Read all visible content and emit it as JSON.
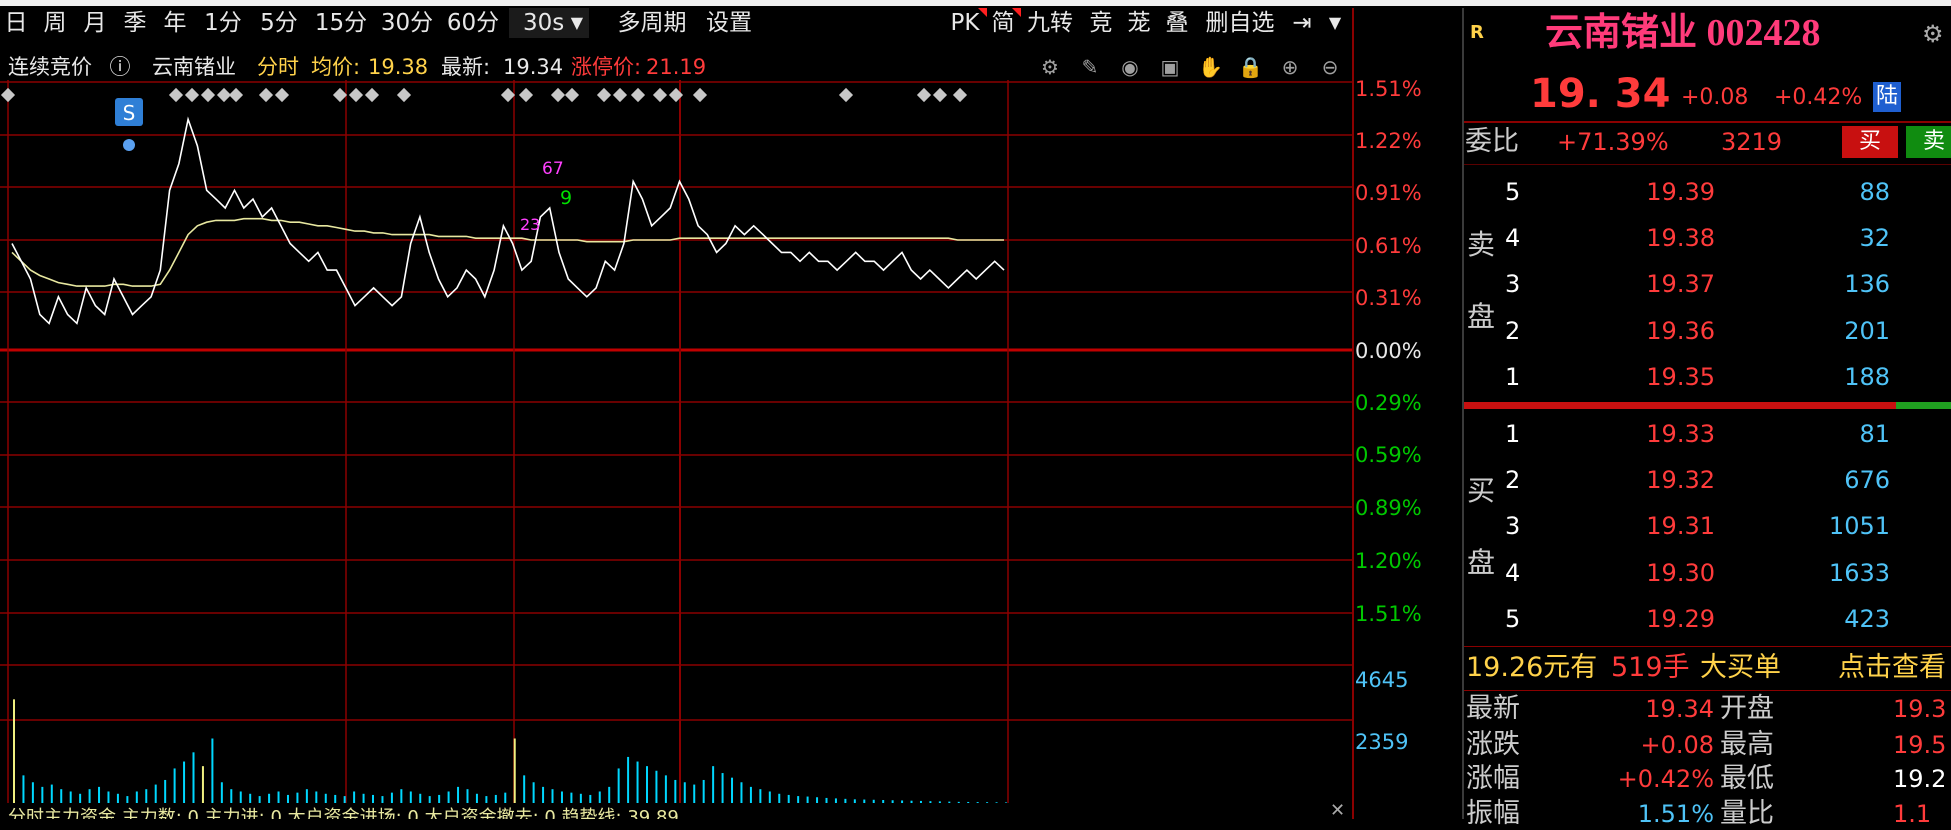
{
  "toolbar": {
    "periods": [
      "日",
      "周",
      "月",
      "季",
      "年",
      "1分",
      "5分",
      "15分",
      "30分",
      "60分",
      "30s"
    ],
    "multi_period": "多周期",
    "settings": "设置",
    "right_buttons": [
      "PK",
      "简",
      "九转",
      "竞",
      "茏",
      "叠",
      "删自选"
    ]
  },
  "header": {
    "mode": "连续竞价",
    "stock_name": "云南锗业",
    "view": "分时",
    "avg_label": "均价:",
    "avg_value": "19.38",
    "latest_label": "最新:",
    "latest_value": "19.34",
    "limit_label": "涨停价:",
    "limit_value": "21.19"
  },
  "chart_data": {
    "type": "line",
    "price_axis_labels_up": [
      "1.51%",
      "1.22%",
      "0.91%",
      "0.61%",
      "0.31%"
    ],
    "price_axis_zero": "0.00%",
    "price_axis_labels_down": [
      "0.29%",
      "0.59%",
      "0.89%",
      "1.20%",
      "1.51%"
    ],
    "volume_axis_labels": [
      "4645",
      "2359"
    ],
    "ylim_percent": [
      -1.51,
      1.51
    ],
    "price_percent": [
      0.6,
      0.5,
      0.4,
      0.2,
      0.15,
      0.3,
      0.2,
      0.15,
      0.35,
      0.25,
      0.2,
      0.4,
      0.3,
      0.2,
      0.25,
      0.3,
      0.45,
      0.9,
      1.05,
      1.3,
      1.15,
      0.9,
      0.85,
      0.8,
      0.9,
      0.8,
      0.85,
      0.75,
      0.8,
      0.7,
      0.6,
      0.55,
      0.5,
      0.55,
      0.45,
      0.45,
      0.35,
      0.25,
      0.3,
      0.35,
      0.3,
      0.25,
      0.3,
      0.6,
      0.75,
      0.55,
      0.4,
      0.3,
      0.35,
      0.45,
      0.4,
      0.3,
      0.45,
      0.7,
      0.6,
      0.45,
      0.5,
      0.75,
      0.8,
      0.55,
      0.4,
      0.35,
      0.3,
      0.35,
      0.5,
      0.45,
      0.6,
      0.95,
      0.85,
      0.7,
      0.75,
      0.8,
      0.95,
      0.85,
      0.7,
      0.65,
      0.55,
      0.6,
      0.7,
      0.65,
      0.7,
      0.65,
      0.6,
      0.55,
      0.55,
      0.5,
      0.55,
      0.5,
      0.5,
      0.45,
      0.5,
      0.55,
      0.5,
      0.5,
      0.45,
      0.5,
      0.55,
      0.45,
      0.4,
      0.45,
      0.4,
      0.35,
      0.4,
      0.45,
      0.4,
      0.45,
      0.5,
      0.45
    ],
    "avg_percent": [
      0.55,
      0.5,
      0.45,
      0.42,
      0.4,
      0.38,
      0.37,
      0.36,
      0.36,
      0.36,
      0.36,
      0.37,
      0.37,
      0.36,
      0.36,
      0.36,
      0.37,
      0.45,
      0.55,
      0.65,
      0.7,
      0.72,
      0.73,
      0.73,
      0.73,
      0.74,
      0.74,
      0.74,
      0.73,
      0.73,
      0.72,
      0.72,
      0.71,
      0.7,
      0.7,
      0.69,
      0.68,
      0.67,
      0.67,
      0.66,
      0.66,
      0.65,
      0.65,
      0.65,
      0.65,
      0.65,
      0.64,
      0.64,
      0.64,
      0.64,
      0.63,
      0.63,
      0.63,
      0.63,
      0.63,
      0.63,
      0.62,
      0.62,
      0.62,
      0.62,
      0.62,
      0.62,
      0.61,
      0.61,
      0.61,
      0.61,
      0.61,
      0.62,
      0.62,
      0.62,
      0.62,
      0.62,
      0.63,
      0.63,
      0.63,
      0.63,
      0.63,
      0.63,
      0.63,
      0.63,
      0.63,
      0.63,
      0.63,
      0.63,
      0.63,
      0.63,
      0.63,
      0.63,
      0.63,
      0.63,
      0.63,
      0.63,
      0.63,
      0.63,
      0.63,
      0.63,
      0.63,
      0.63,
      0.63,
      0.63,
      0.63,
      0.63,
      0.62,
      0.62,
      0.62,
      0.62,
      0.62,
      0.62
    ],
    "volume": [
      4500,
      1200,
      900,
      700,
      800,
      600,
      500,
      400,
      600,
      700,
      500,
      400,
      300,
      500,
      600,
      800,
      1000,
      1500,
      1800,
      2200,
      1600,
      2800,
      900,
      600,
      500,
      400,
      300,
      400,
      500,
      350,
      450,
      600,
      500,
      400,
      350,
      300,
      500,
      400,
      350,
      300,
      450,
      600,
      500,
      400,
      300,
      350,
      500,
      700,
      600,
      400,
      300,
      350,
      450,
      2800,
      1200,
      900,
      700,
      600,
      500,
      450,
      400,
      350,
      500,
      700,
      1500,
      2000,
      1800,
      1600,
      1400,
      1200,
      1000,
      900,
      800,
      1000,
      1600,
      1300,
      1100,
      900,
      700,
      600,
      500,
      400,
      350,
      300,
      280,
      250,
      220,
      200,
      180,
      160,
      150,
      140,
      130,
      120,
      110,
      100,
      90,
      80,
      70,
      60,
      50,
      45,
      40,
      35,
      30,
      25
    ]
  },
  "markers": {
    "s_label": "S",
    "label_67": "67",
    "label_9": "9",
    "label_23": "23"
  },
  "panel": {
    "badge": "R",
    "name_code": "云南锗业 002428",
    "price": "19. 34",
    "change": "+0.08",
    "change_pct": "+0.42%",
    "lu_badge": "陆",
    "weibi_label": "委比",
    "weibi_value": "+71.39%",
    "weibi_diff": "3219",
    "buy_btn": "买",
    "sell_btn": "卖",
    "sell_side_label": [
      "卖",
      "盘"
    ],
    "buy_side_label": [
      "买",
      "盘"
    ],
    "asks": [
      {
        "level": "5",
        "price": "19.39",
        "vol": "88"
      },
      {
        "level": "4",
        "price": "19.38",
        "vol": "32"
      },
      {
        "level": "3",
        "price": "19.37",
        "vol": "136"
      },
      {
        "level": "2",
        "price": "19.36",
        "vol": "201"
      },
      {
        "level": "1",
        "price": "19.35",
        "vol": "188"
      }
    ],
    "bids": [
      {
        "level": "1",
        "price": "19.33",
        "vol": "81"
      },
      {
        "level": "2",
        "price": "19.32",
        "vol": "676"
      },
      {
        "level": "3",
        "price": "19.31",
        "vol": "1051"
      },
      {
        "level": "4",
        "price": "19.30",
        "vol": "1633"
      },
      {
        "level": "5",
        "price": "19.29",
        "vol": "423"
      }
    ],
    "big_order_price": "19.26元有",
    "big_order_vol": "519手",
    "big_order_text": "大买单",
    "big_order_link": "点击查看",
    "stats": [
      {
        "label": "最新",
        "value": "19.34",
        "label2": "开盘",
        "value2": "19.3"
      },
      {
        "label": "涨跌",
        "value": "+0.08",
        "label2": "最高",
        "value2": "19.5"
      },
      {
        "label": "涨幅",
        "value": "+0.42%",
        "label2": "最低",
        "value2": "19.2"
      },
      {
        "label": "振幅",
        "value": "1.51%",
        "label2": "量比",
        "value2": "1.1"
      }
    ]
  },
  "footer": {
    "partial_text": "分时主力资金  主力数: 0  主力进: 0  大户资金进场: 0  大户资金撤去: 0  趋势线: 39.89"
  },
  "colors": {
    "up": "#ff3b3b",
    "down": "#00c800",
    "price_line": "#ffffff",
    "avg_line": "#e8e8a0",
    "volume": "#00d8ff",
    "grid": "#8b0000"
  }
}
